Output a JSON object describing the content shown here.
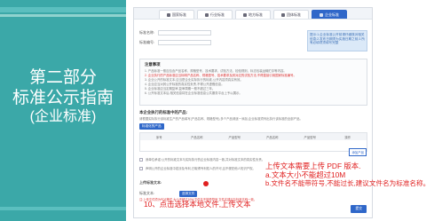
{
  "left_panel": {
    "line1": "第二部分",
    "line2": "标准公示指南",
    "line3": "(企业标准)"
  },
  "tabs": [
    {
      "label": "国家标准",
      "icon": "flag-icon"
    },
    {
      "label": "行业标准",
      "icon": "doc-icon"
    },
    {
      "label": "地方标准",
      "icon": "map-icon"
    },
    {
      "label": "团体标准",
      "icon": "group-icon"
    },
    {
      "label": "企业标准",
      "icon": "building-icon",
      "active": true
    }
  ],
  "form": {
    "name_label": "标准名称:",
    "code_label": "标准编号:",
    "hint": "提示:1.企业标准公开前请仔细核对相关信息;2.发布日期须为实施日期之前;3.所有必填项须填写完整"
  },
  "notice": {
    "title": "注意事项",
    "lines": [
      "1. 产品标准一般应包含产品名称、规格型号、技术要求、试验方法、检验规则、标志包装运输贮存等内容。",
      "2. 企业执行的产品标准应当标明产品名称、规格型号、技术要求及其对应的试验方法,不得直接引用国家标准编号。",
      "3. 企业公开的标准文本,应当是企业实际执行的标准,公开内容须真实有效。",
      "4. 企业应当对其公开标准的真实性负责,不得公开虚假信息。",
      "5. 企业标准应当定期复审,复审周期一般不超过三年。",
      "6. 公开标准文本后,相关信息将在企业标准信息公共服务平台上予以展示。"
    ]
  },
  "products": {
    "title": "本企业执行的标准中的产品:",
    "desc": "请根据实际执行该标准生产的产品填写(产品名称、规格型号),多个产品请逐一添加,企业标准须列出执行该标准的全部产品。",
    "button": "标准化的产品",
    "columns": [
      "序号",
      "产品名称",
      "产品型号",
      "产品名称",
      "产品型号",
      "操作"
    ],
    "add_button": "添加产品"
  },
  "checks": [
    "我单位承诺:公开的标准文本与实际执行的企业标准内容一致,并对标准文本的真实性负责。",
    "声明公开的企业标准中若涉及专利,已取得专利权人的许可,且不侵犯他人知识产权。"
  ],
  "upload": {
    "label": "上传标准文本:",
    "sub_label": "标准文本:",
    "button": "选择文件",
    "warning": "注:上传文件须为PDF格式,大小不超过10M,文件名不能带符号,文件名建议与标准名称一致。"
  },
  "submit_button": "提交",
  "annotations": {
    "line1": "上传文本需要上传 PDF 版本.",
    "line2": "a.文本大小不能超过10M",
    "line3": "b.文件名不能带符号,不能过长,建议文件名为标准名称。",
    "bottom": "10、点击选择本地文件,上传文本"
  }
}
